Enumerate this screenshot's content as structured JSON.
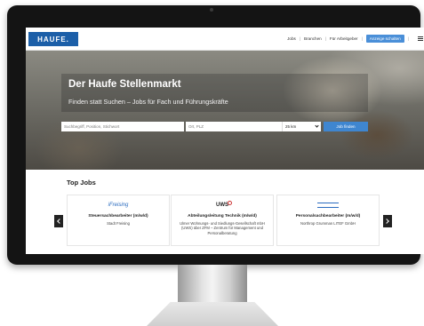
{
  "header": {
    "logo_text": "HAUFE.",
    "nav": [
      "Jobs",
      "Branchen",
      "Für Arbeitgeber"
    ],
    "cta_label": "Anzeige schalten",
    "menu_icon": "hamburger-icon"
  },
  "hero": {
    "title": "Der Haufe Stellenmarkt",
    "subtitle": "Finden statt Suchen – Jobs für Fach und Führungskräfte",
    "keyword_placeholder": "Suchbegriff, Position, Stichwort",
    "location_placeholder": "Ort, PLZ",
    "radius_value": "25 km",
    "search_button": "Job finden"
  },
  "top_jobs": {
    "title": "Top Jobs",
    "cards": [
      {
        "logo": "iFreising",
        "title": "Steuersachbearbeiter (m/w/d)",
        "company": "Stadt Freising"
      },
      {
        "logo": "UWS",
        "title": "Abteilungsleitung Technik (m/w/d)",
        "company": "Ulmer Wohnungs- und Siedlungs-Gesellschaft mbH (UWS) über ZFM – Zentrum für Management und Personalberatung"
      },
      {
        "logo": "Northrop Grumman",
        "title": "Personalsachbearbeiter (m/w/d)",
        "company": "Northrop Grumman LITEF GmbH"
      }
    ]
  },
  "colors": {
    "brand": "#1c5fa8",
    "accent": "#3f86d0",
    "bezel": "#141414"
  }
}
